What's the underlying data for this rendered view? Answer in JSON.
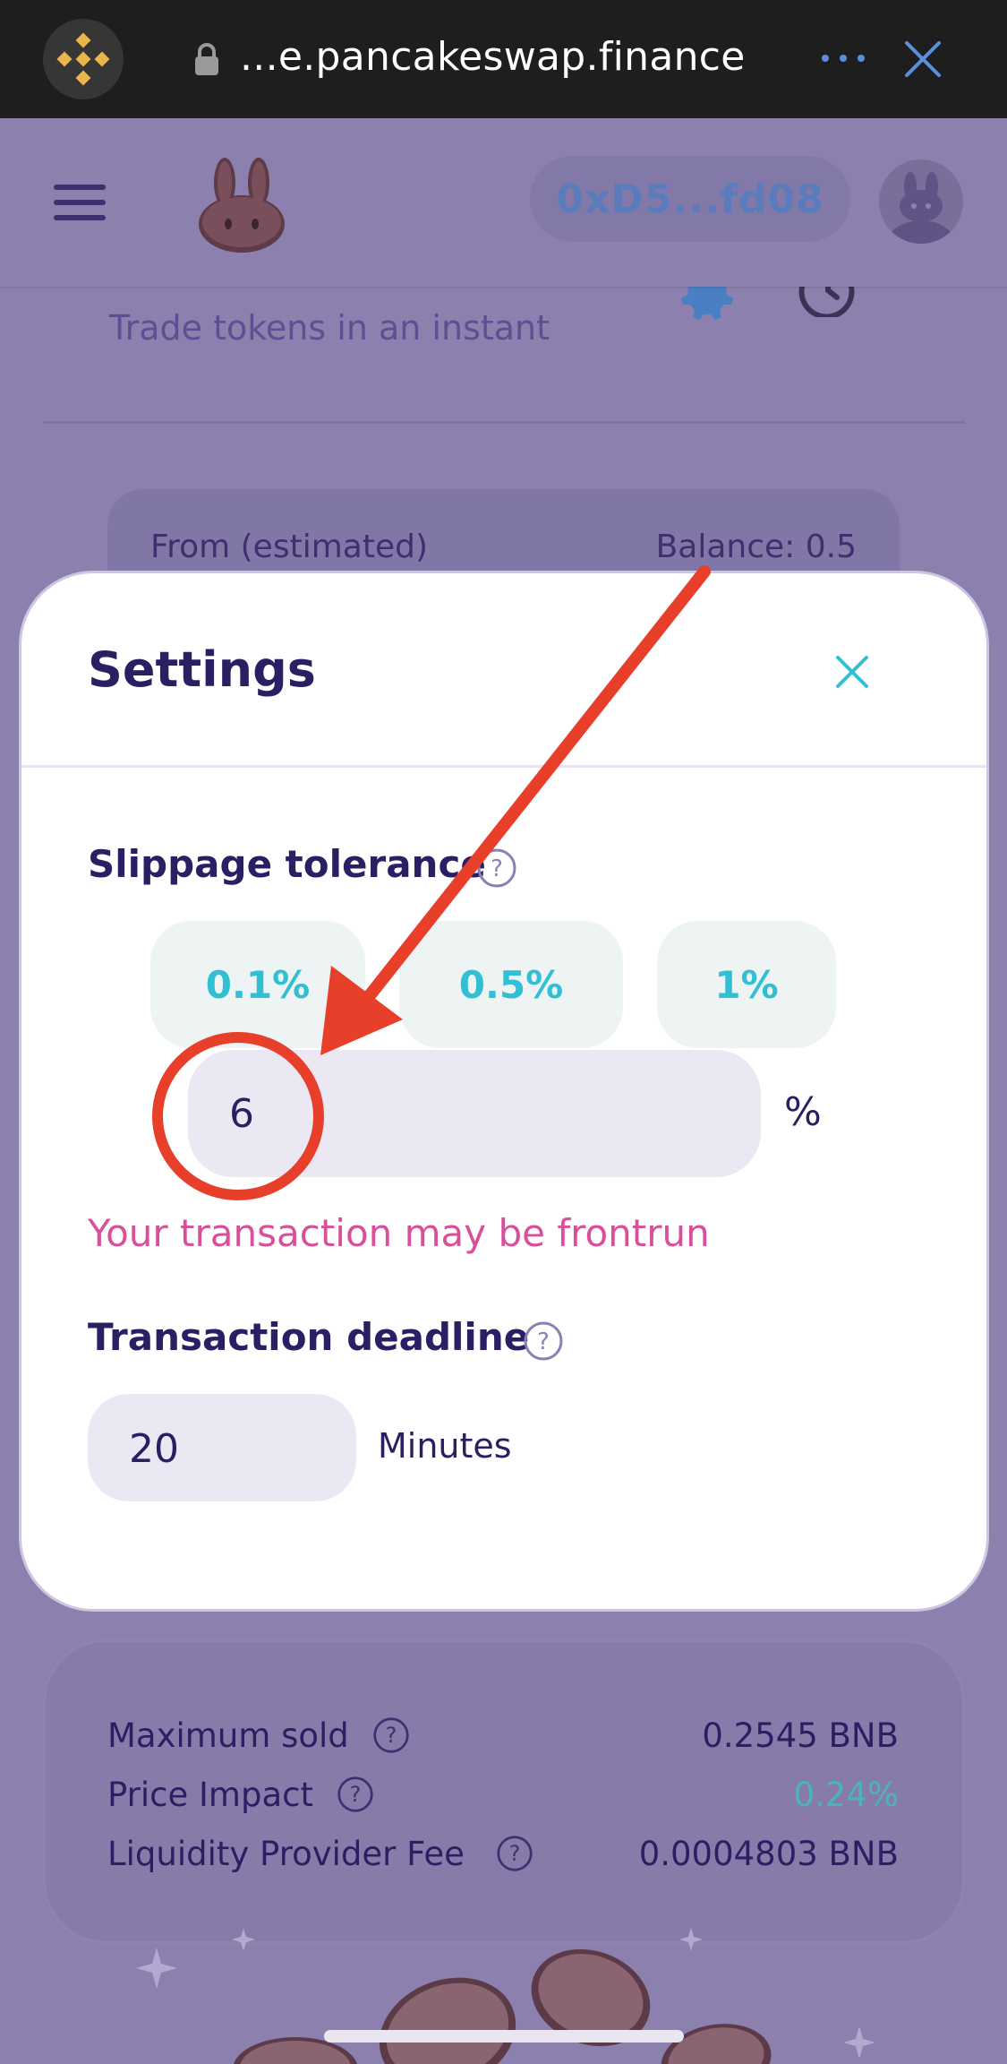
{
  "browser": {
    "url": "...e.pancakeswap.finance",
    "more_icon": "more-dots-icon",
    "close_icon": "close-icon"
  },
  "header": {
    "wallet_address": "0xD5...fd08",
    "menu_icon": "hamburger-menu-icon",
    "logo_icon": "pancake-bunny-icon",
    "avatar_icon": "bunny-avatar-icon"
  },
  "swap": {
    "subtitle": "Trade tokens in an instant",
    "from_label": "From (estimated)",
    "balance_label": "Balance: 0.5"
  },
  "settings": {
    "title": "Settings",
    "slippage_label": "Slippage tolerance",
    "presets": [
      "0.1%",
      "0.5%",
      "1%"
    ],
    "slippage_value": "6",
    "percent_sign": "%",
    "warning": "Your transaction may be frontrun",
    "deadline_label": "Transaction deadline",
    "deadline_value": "20",
    "deadline_unit": "Minutes"
  },
  "details": {
    "rows": [
      {
        "label": "Maximum sold",
        "value": "0.2545 BNB"
      },
      {
        "label": "Price Impact",
        "value": "0.24%"
      },
      {
        "label": "Liquidity Provider Fee",
        "value": "0.0004803 BNB"
      }
    ]
  },
  "colors": {
    "accent_cyan": "#31bfd3",
    "text_dark": "#2c1e63",
    "warning_pink": "#d8509a",
    "annotation_red": "#e83f2a",
    "overlay_purple": "#8c80ae"
  }
}
